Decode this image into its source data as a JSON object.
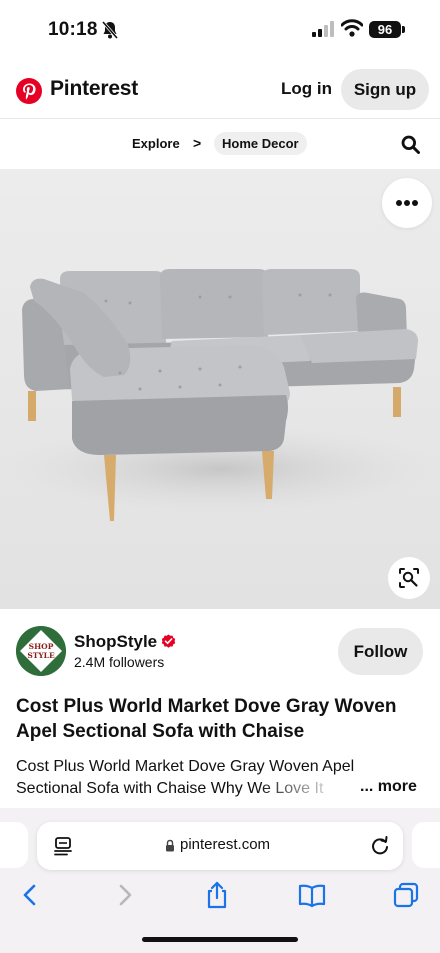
{
  "status_bar": {
    "time": "10:18",
    "battery": "96"
  },
  "header": {
    "brand": "Pinterest",
    "login_label": "Log in",
    "signup_label": "Sign up",
    "brand_color": "#e60023"
  },
  "breadcrumb": {
    "items": [
      "Explore",
      "Home Decor"
    ],
    "separator": ">"
  },
  "pin": {
    "image_alt": "Gray sectional sofa with chaise",
    "creator": {
      "name": "ShopStyle",
      "followers": "2.4M followers",
      "avatar_text": [
        "SHOP",
        "STYLE"
      ],
      "verified": true
    },
    "follow_label": "Follow",
    "title": "Cost Plus World Market Dove Gray Woven Apel Sectional Sofa with Chaise",
    "description": "Cost Plus World Market Dove Gray Woven Apel Sectional Sofa with Chaise Why We Love It",
    "more_label": "... more"
  },
  "browser": {
    "url": "pinterest.com",
    "toolbar_icons": [
      "back-icon",
      "forward-icon",
      "share-icon",
      "bookmarks-icon",
      "tabs-icon"
    ],
    "accent": "#1a73e8"
  }
}
